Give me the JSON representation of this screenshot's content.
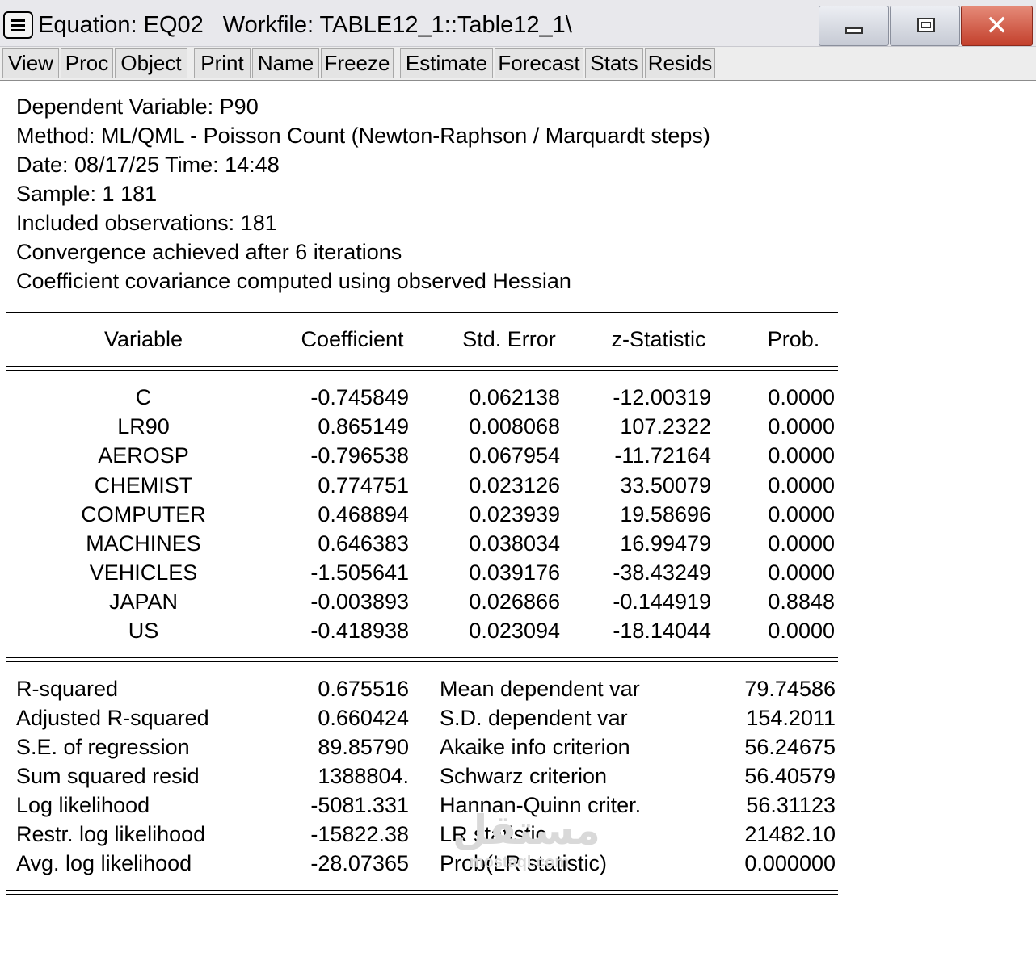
{
  "window": {
    "title_equation": "Equation: EQ02",
    "title_workfile": "Workfile: TABLE12_1::Table12_1\\",
    "controls": {
      "minimize": "minimize",
      "maximize": "maximize",
      "close": "✕"
    }
  },
  "toolbar": [
    "View",
    "Proc",
    "Object",
    "Print",
    "Name",
    "Freeze",
    "Estimate",
    "Forecast",
    "Stats",
    "Resids"
  ],
  "header_lines": [
    "Dependent Variable: P90",
    "Method: ML/QML - Poisson Count  (Newton-Raphson / Marquardt steps)",
    "Date: 08/17/25   Time: 14:48",
    "Sample: 1 181",
    "Included observations: 181",
    "Convergence achieved after 6 iterations",
    "Coefficient covariance computed using observed Hessian"
  ],
  "coef_table": {
    "columns": [
      "Variable",
      "Coefficient",
      "Std. Error",
      "z-Statistic",
      "Prob."
    ],
    "rows": [
      [
        "C",
        "-0.745849",
        "0.062138",
        "-12.00319",
        "0.0000"
      ],
      [
        "LR90",
        "0.865149",
        "0.008068",
        "107.2322",
        "0.0000"
      ],
      [
        "AEROSP",
        "-0.796538",
        "0.067954",
        "-11.72164",
        "0.0000"
      ],
      [
        "CHEMIST",
        "0.774751",
        "0.023126",
        "33.50079",
        "0.0000"
      ],
      [
        "COMPUTER",
        "0.468894",
        "0.023939",
        "19.58696",
        "0.0000"
      ],
      [
        "MACHINES",
        "0.646383",
        "0.038034",
        "16.99479",
        "0.0000"
      ],
      [
        "VEHICLES",
        "-1.505641",
        "0.039176",
        "-38.43249",
        "0.0000"
      ],
      [
        "JAPAN",
        "-0.003893",
        "0.026866",
        "-0.144919",
        "0.8848"
      ],
      [
        "US",
        "-0.418938",
        "0.023094",
        "-18.14044",
        "0.0000"
      ]
    ]
  },
  "stats": [
    [
      "R-squared",
      "0.675516",
      "Mean dependent var",
      "79.74586"
    ],
    [
      "Adjusted R-squared",
      "0.660424",
      "S.D. dependent var",
      "154.2011"
    ],
    [
      "S.E. of regression",
      "89.85790",
      "Akaike info criterion",
      "56.24675"
    ],
    [
      "Sum squared resid",
      "1388804.",
      "Schwarz criterion",
      "56.40579"
    ],
    [
      "Log likelihood",
      "-5081.331",
      "Hannan-Quinn criter.",
      "56.31123"
    ],
    [
      "Restr. log likelihood",
      "-15822.38",
      "LR statistic",
      "21482.10"
    ],
    [
      "Avg. log likelihood",
      "-28.07365",
      "Prob(LR statistic)",
      "0.000000"
    ]
  ],
  "watermark": {
    "arabic": "مستقل",
    "latin": "mostaql.com"
  }
}
